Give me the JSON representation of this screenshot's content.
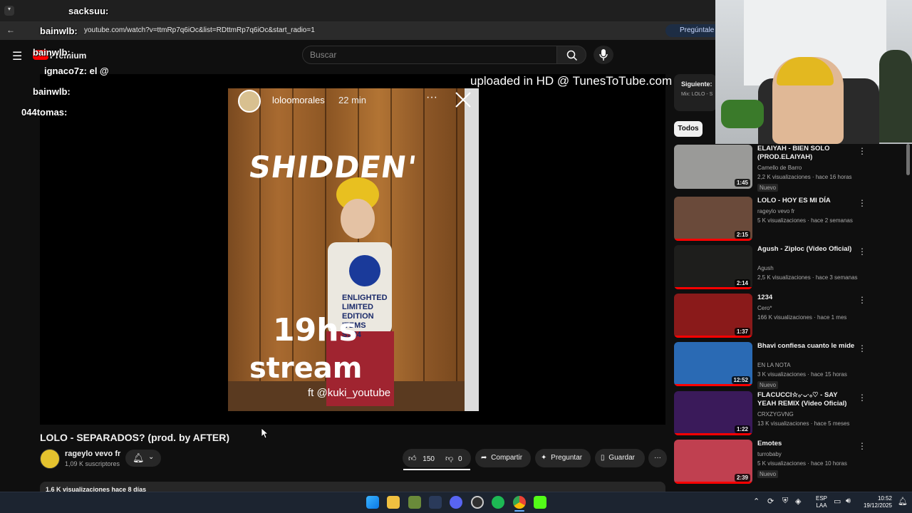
{
  "browser": {
    "url": "youtube.com/watch?v=ttmRp7q6iOc&list=RDttmRp7q6iOc&start_radio=1",
    "ask_label": "Pregúntale a"
  },
  "youtube": {
    "logo_label": "Premium",
    "search_placeholder": "Buscar"
  },
  "player": {
    "watermark": "uploaded in HD @ TunesToTube.com",
    "story_user": "loloomorales",
    "story_time": "22 min",
    "wall_text": "SHIDDEN'",
    "shirt_text": "ENLIGHTED LIMITED EDITION ITEMS SS24",
    "overlay_line1": "19hs",
    "overlay_line2": "stream",
    "overlay_line3": "ft @kuki_youtube"
  },
  "video": {
    "title": "LOLO - SEPARADOS? (prod. by AFTER)",
    "channel": "rageylo vevo fr",
    "subscribers": "1,09 K suscriptores",
    "likes": "150",
    "dislikes": "0",
    "share_label": "Compartir",
    "ask_label": "Preguntar",
    "save_label": "Guardar",
    "description_preview": "1,6 K visualizaciones  hace 8 días"
  },
  "sidebar": {
    "next_label": "Siguiente:",
    "next_mix": "Mix: LOLO - S",
    "chip_all": "Todos",
    "items": [
      {
        "title": "ELAIYAH - BIEN SOLO (PROD.ELAIYAH)",
        "channel": "Camello de Barro",
        "views": "2,2 K visualizaciones · hace 16 horas",
        "duration": "1:45",
        "badge": "Nuevo",
        "thumb": "#9a9a98"
      },
      {
        "title": "LOLO - HOY ES MI DÍA",
        "channel": "rageylo vevo fr",
        "views": "5 K visualizaciones · hace 2 semanas",
        "duration": "2:15",
        "badge": "",
        "thumb": "#6a4a3a"
      },
      {
        "title": "Agush - Ziploc (Video Oficial)",
        "channel": "Agush",
        "views": "2,5 K visualizaciones · hace 3 semanas",
        "duration": "2:14",
        "badge": "",
        "thumb": "#1e1e1c"
      },
      {
        "title": "1234",
        "channel": "Cero*",
        "views": "166 K visualizaciones · hace 1 mes",
        "duration": "1:37",
        "badge": "",
        "thumb": "#8a1a1a"
      },
      {
        "title": "Bhavi confiesa cuanto le mide",
        "channel": "EN LA NOTA",
        "views": "3 K visualizaciones · hace 15 horas",
        "duration": "12:52",
        "badge": "Nuevo",
        "thumb": "#2a6ab4"
      },
      {
        "title": "FLACUCCI☆ₒ·ᴗ·ₒ♡ - SAY YEAH REMIX (Video Oficial)",
        "channel": "CRXZYGVNG",
        "views": "13 K visualizaciones · hace 5 meses",
        "duration": "1:22",
        "badge": "",
        "thumb": "#3a1a5a"
      },
      {
        "title": "Emotes",
        "channel": "turrobaby",
        "views": "5 K visualizaciones · hace 10 horas",
        "duration": "2:39",
        "badge": "Nuevo",
        "thumb": "#c04050"
      }
    ]
  },
  "chat": [
    {
      "user": "sacksuu:",
      "msg": ""
    },
    {
      "user": "bainwlb:",
      "msg": ""
    },
    {
      "user": "bainwlb:",
      "msg": ""
    },
    {
      "user": "ignaco7z:",
      "msg": "el @"
    },
    {
      "user": "bainwlb:",
      "msg": ""
    },
    {
      "user": "044tomas:",
      "msg": ""
    }
  ],
  "taskbar": {
    "lang1": "ESP",
    "lang2": "LAA",
    "time": "10:52",
    "date": "19/12/2025"
  }
}
